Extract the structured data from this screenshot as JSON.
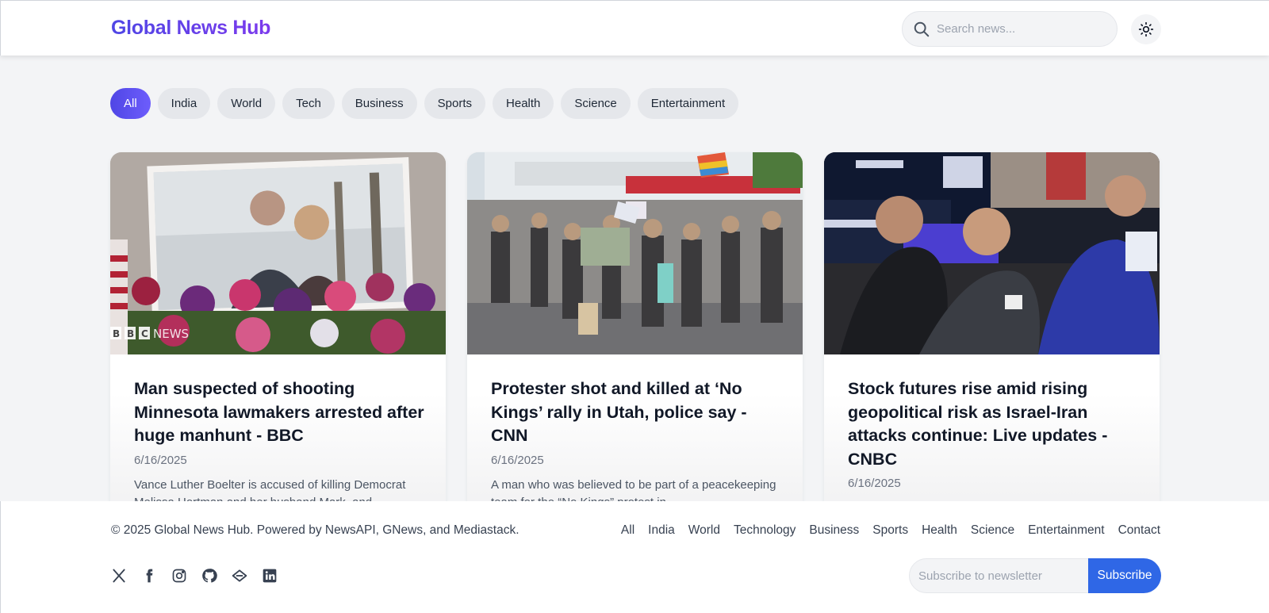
{
  "header": {
    "logo": "Global News Hub",
    "search_placeholder": "Search news...",
    "theme_icon": "sun-icon"
  },
  "categories": [
    {
      "label": "All",
      "active": true
    },
    {
      "label": "India"
    },
    {
      "label": "World"
    },
    {
      "label": "Tech"
    },
    {
      "label": "Business"
    },
    {
      "label": "Sports"
    },
    {
      "label": "Health"
    },
    {
      "label": "Science"
    },
    {
      "label": "Entertainment"
    }
  ],
  "articles": [
    {
      "title": "Man suspected of shooting Minnesota lawmakers arrested after huge manhunt - BBC",
      "date": "6/16/2025",
      "description": "Vance Luther Boelter is accused of killing Democrat Melissa Hortman and her husband Mark, and",
      "image_watermark": "BBC NEWS"
    },
    {
      "title": "Protester shot and killed at ‘No Kings’ rally in Utah, police say - CNN",
      "date": "6/16/2025",
      "description": "A man who was believed to be part of a peacekeeping team for the “No Kings” protest in"
    },
    {
      "title": "Stock futures rise amid rising geopolitical risk as Israel-Iran attacks continue: Live updates - CNBC",
      "date": "6/16/2025",
      "description": ""
    }
  ],
  "footer": {
    "copyright": "© 2025 Global News Hub. Powered by NewsAPI, GNews, and Mediastack.",
    "links": [
      "All",
      "India",
      "World",
      "Technology",
      "Business",
      "Sports",
      "Health",
      "Science",
      "Entertainment",
      "Contact"
    ],
    "socials": [
      "x-icon",
      "facebook-icon",
      "instagram-icon",
      "github-icon",
      "dev-icon",
      "linkedin-icon"
    ],
    "newsletter_placeholder": "Subscribe to newsletter",
    "subscribe_label": "Subscribe"
  },
  "colors": {
    "brand_gradient_start": "#4f46e5",
    "brand_gradient_end": "#7c3aed",
    "subscribe_button": "#2f67e6",
    "page_background": "#f3f4f6"
  }
}
